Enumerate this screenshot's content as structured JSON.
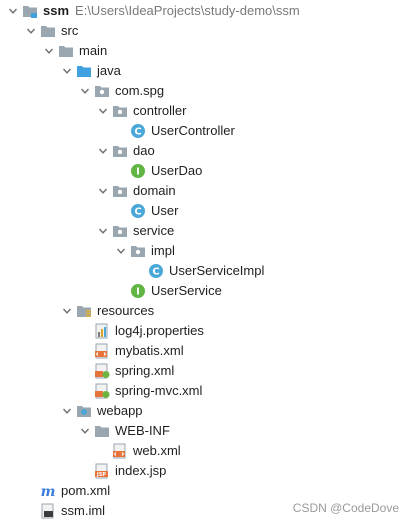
{
  "project": {
    "name": "ssm",
    "path": "E:\\Users\\IdeaProjects\\study-demo\\ssm"
  },
  "nodes": {
    "src": "src",
    "main": "main",
    "java": "java",
    "com_spg": "com.spg",
    "controller": "controller",
    "user_controller": "UserController",
    "dao": "dao",
    "user_dao": "UserDao",
    "domain": "domain",
    "user": "User",
    "service": "service",
    "impl": "impl",
    "user_service_impl": "UserServiceImpl",
    "user_service": "UserService",
    "resources": "resources",
    "log4j": "log4j.properties",
    "mybatis": "mybatis.xml",
    "spring": "spring.xml",
    "spring_mvc": "spring-mvc.xml",
    "webapp": "webapp",
    "web_inf": "WEB-INF",
    "web_xml": "web.xml",
    "index_jsp": "index.jsp",
    "pom": "pom.xml",
    "ssm_iml": "ssm.iml"
  },
  "watermark": "CSDN @CodeDove",
  "icons": {
    "folder": "folder-icon",
    "source_folder": "source-folder-icon",
    "resources_folder": "resources-folder-icon",
    "web_folder": "web-folder-icon",
    "package": "package-icon",
    "class": "class-icon",
    "interface": "interface-icon",
    "properties": "properties-file-icon",
    "xml": "xml-file-icon",
    "spring_xml": "spring-xml-file-icon",
    "jsp": "jsp-file-icon",
    "maven": "maven-icon",
    "module": "module-icon"
  },
  "colors": {
    "class": "#4aa8d8",
    "interface": "#62b543",
    "folder": "#9aa7b0",
    "source_folder": "#40a0e0",
    "xml": "#e8733a",
    "spring": "#6db33f",
    "maven": "#3b7ddd"
  }
}
